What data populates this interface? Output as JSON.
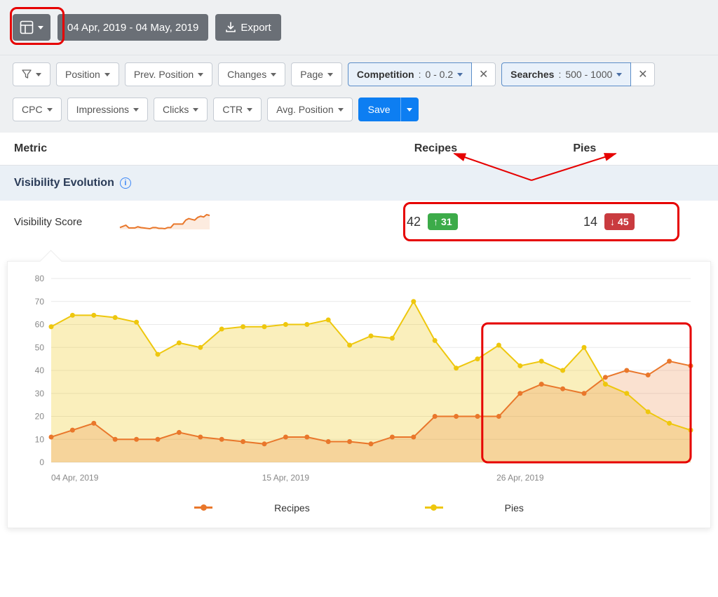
{
  "toolbar": {
    "date_range": "04 Apr, 2019 - 04 May, 2019",
    "export_label": "Export"
  },
  "filters": {
    "simple": [
      "Position",
      "Prev. Position",
      "Changes",
      "Page"
    ],
    "simple2": [
      "CPC",
      "Impressions",
      "Clicks",
      "CTR",
      "Avg. Position"
    ],
    "active": [
      {
        "label": "Competition",
        "value": "0 - 0.2"
      },
      {
        "label": "Searches",
        "value": "500 - 1000"
      }
    ],
    "save_label": "Save"
  },
  "columns": {
    "metric": "Metric",
    "c1": "Recipes",
    "c2": "Pies"
  },
  "section": {
    "title": "Visibility Evolution"
  },
  "score_row": {
    "label": "Visibility Score",
    "recipes": {
      "value": "42",
      "change": "31",
      "dir": "up"
    },
    "pies": {
      "value": "14",
      "change": "45",
      "dir": "down"
    }
  },
  "chart_data": {
    "type": "area",
    "title": "",
    "xlabel": "",
    "ylabel": "",
    "ylim": [
      0,
      80
    ],
    "y_ticks": [
      0,
      10,
      20,
      30,
      40,
      50,
      60,
      70,
      80
    ],
    "x_ticks": [
      "04 Apr, 2019",
      "15 Apr, 2019",
      "26 Apr, 2019"
    ],
    "dates": [
      "2019-04-04",
      "2019-04-05",
      "2019-04-06",
      "2019-04-07",
      "2019-04-08",
      "2019-04-09",
      "2019-04-10",
      "2019-04-11",
      "2019-04-12",
      "2019-04-13",
      "2019-04-14",
      "2019-04-15",
      "2019-04-16",
      "2019-04-17",
      "2019-04-18",
      "2019-04-19",
      "2019-04-20",
      "2019-04-21",
      "2019-04-22",
      "2019-04-23",
      "2019-04-24",
      "2019-04-25",
      "2019-04-26",
      "2019-04-27",
      "2019-04-28",
      "2019-04-29",
      "2019-04-30",
      "2019-05-01",
      "2019-05-02",
      "2019-05-03",
      "2019-05-04"
    ],
    "series": [
      {
        "name": "Recipes",
        "color": "#e9772b",
        "fill": "rgba(233,119,43,0.22)",
        "values": [
          11,
          14,
          17,
          10,
          10,
          10,
          13,
          11,
          10,
          9,
          8,
          11,
          11,
          9,
          9,
          8,
          11,
          11,
          20,
          20,
          20,
          20,
          30,
          34,
          32,
          30,
          37,
          40,
          38,
          44,
          42
        ]
      },
      {
        "name": "Pies",
        "color": "#eec70d",
        "fill": "rgba(238,199,13,0.28)",
        "values": [
          59,
          64,
          64,
          63,
          61,
          47,
          52,
          50,
          58,
          59,
          59,
          60,
          60,
          62,
          51,
          55,
          54,
          70,
          53,
          41,
          45,
          51,
          42,
          44,
          40,
          50,
          34,
          30,
          22,
          17,
          14
        ]
      }
    ],
    "legend": [
      "Recipes",
      "Pies"
    ]
  }
}
